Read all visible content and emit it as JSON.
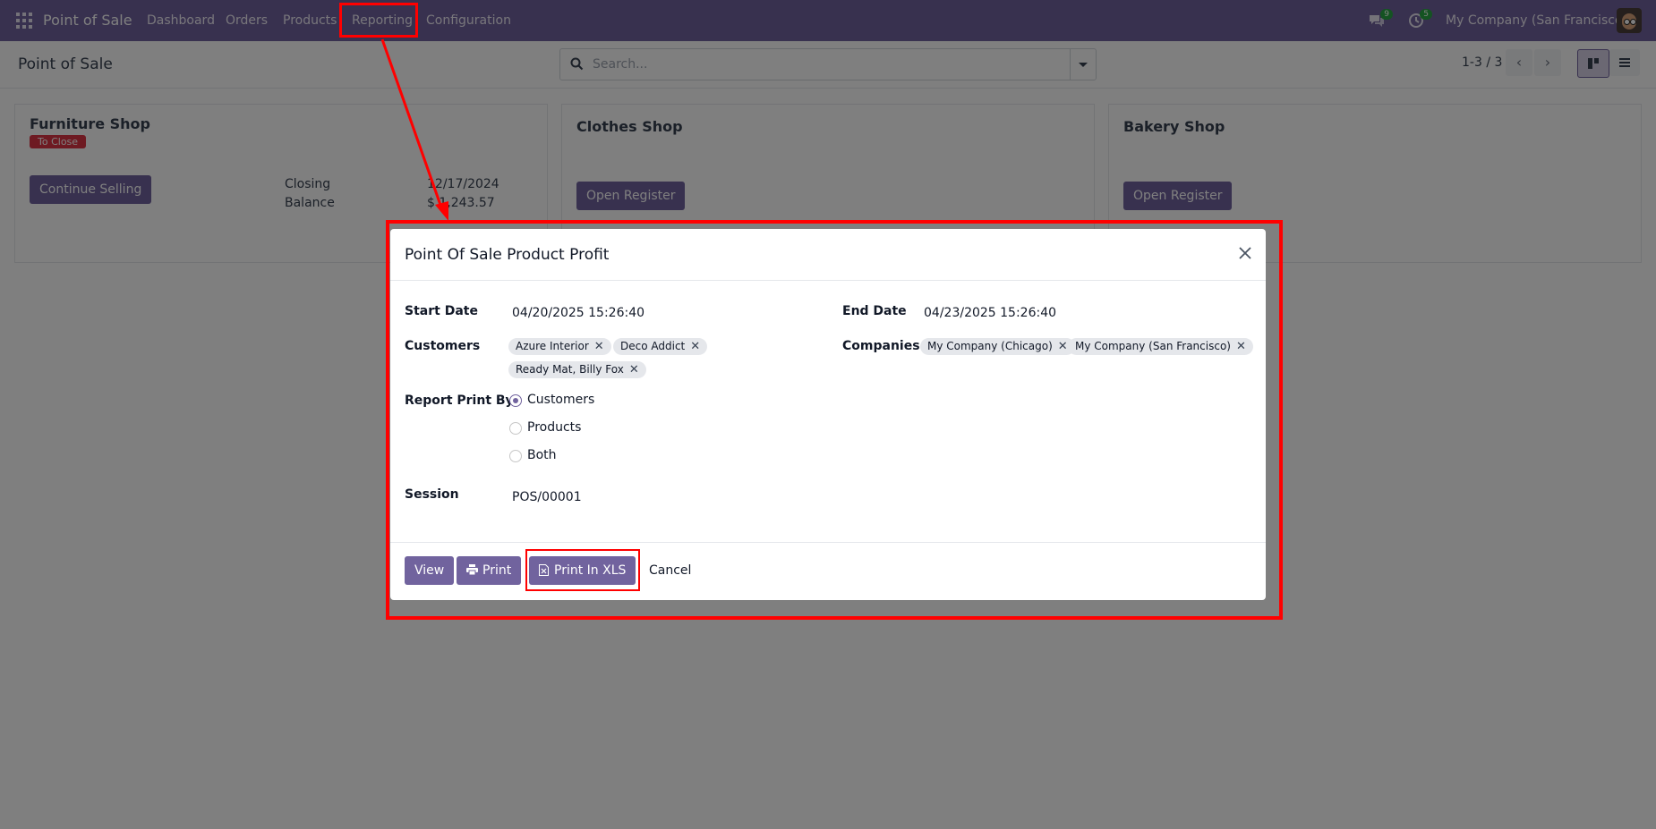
{
  "topbar": {
    "app_name": "Point of Sale",
    "menu": [
      "Dashboard",
      "Orders",
      "Products",
      "Reporting",
      "Configuration"
    ],
    "messages_count": "9",
    "activities_count": "5",
    "company": "My Company (San Francisco)"
  },
  "control": {
    "title": "Point of Sale",
    "search_placeholder": "Search...",
    "pager": "1-3 / 3"
  },
  "cards": [
    {
      "title": "Furniture Shop",
      "status": "To Close",
      "button": "Continue Selling",
      "closing_label": "Closing",
      "closing_value": "12/17/2024",
      "balance_label": "Balance",
      "balance_value": "$ 1,243.57"
    },
    {
      "title": "Clothes Shop",
      "button": "Open Register"
    },
    {
      "title": "Bakery Shop",
      "button": "Open Register"
    }
  ],
  "dialog": {
    "title": "Point Of Sale Product Profit",
    "start_date_label": "Start Date",
    "start_date": "04/20/2025 15:26:40",
    "end_date_label": "End Date",
    "end_date": "04/23/2025 15:26:40",
    "customers_label": "Customers",
    "customers": [
      "Azure Interior",
      "Deco Addict",
      "Ready Mat, Billy Fox"
    ],
    "companies_label": "Companies",
    "companies": [
      "My Company (Chicago)",
      "My Company (San Francisco)"
    ],
    "report_print_by_label": "Report Print By",
    "report_options": [
      "Customers",
      "Products",
      "Both"
    ],
    "report_selected": "Customers",
    "session_label": "Session",
    "session": "POS/00001",
    "buttons": {
      "view": "View",
      "print": "Print",
      "print_xls": "Print In XLS",
      "cancel": "Cancel"
    }
  },
  "colors": {
    "brand": "#71639e",
    "annotation": "#ff0000",
    "danger": "#dc3545"
  }
}
